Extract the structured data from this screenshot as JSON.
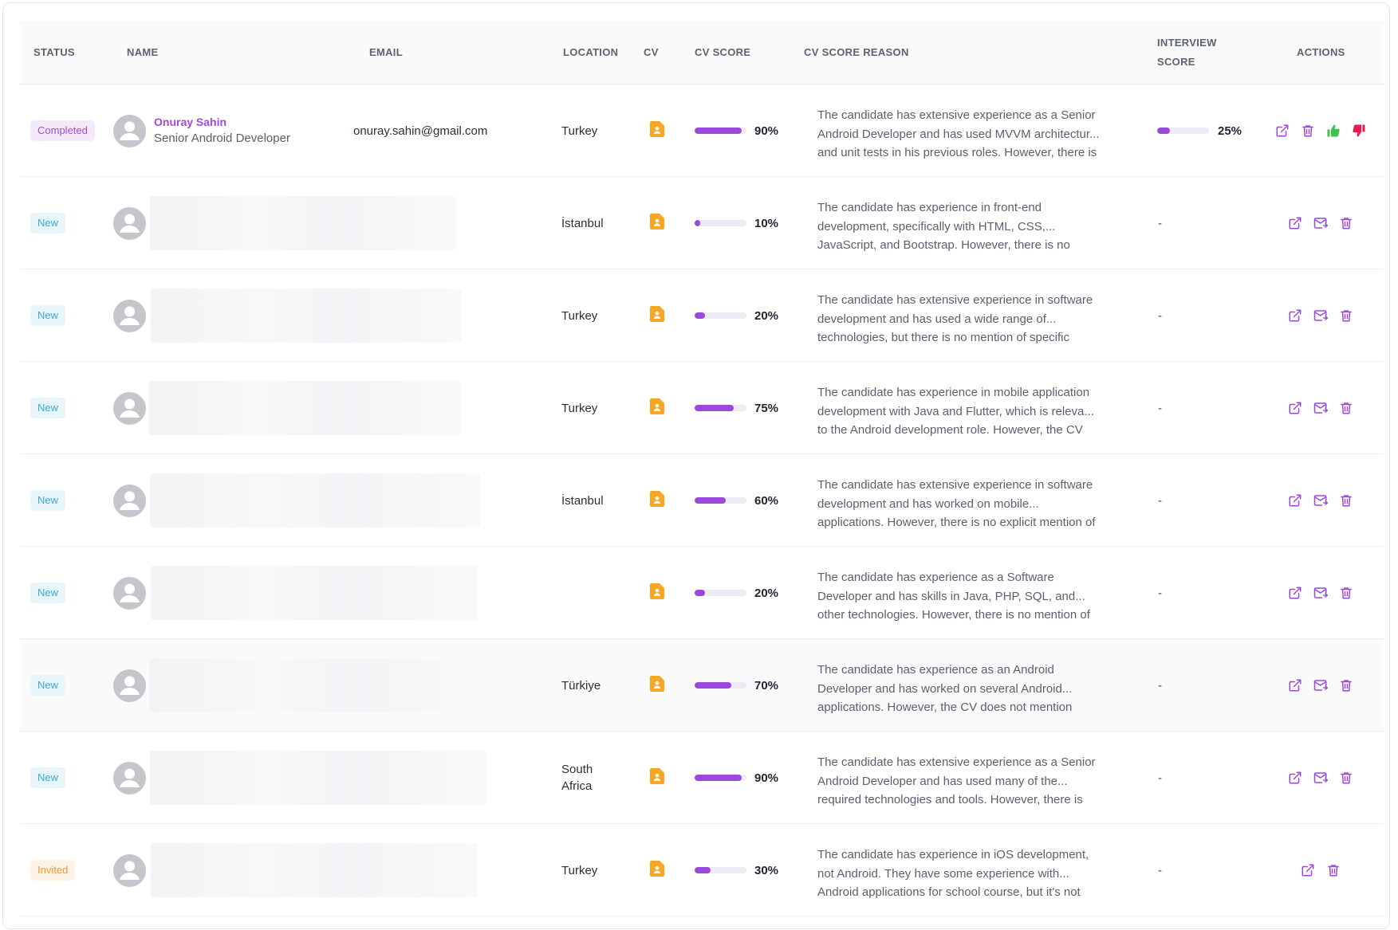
{
  "colors": {
    "accent": "#9a48dd",
    "cv_icon": "#f5a623",
    "thumb_up": "#3cc24a",
    "thumb_down": "#e8194f",
    "badge_completed": "#a649d7",
    "badge_new": "#3ba7d6",
    "badge_invited": "#f29a3a"
  },
  "headers": {
    "status": "STATUS",
    "name": "NAME",
    "email": "EMAIL",
    "location": "LOCATION",
    "cv": "CV",
    "cv_score": "CV SCORE",
    "cv_score_reason": "CV SCORE REASON",
    "interview_line1": "INTERVIEW",
    "interview_line2": "SCORE",
    "actions": "ACTIONS"
  },
  "rows": [
    {
      "status": "Completed",
      "status_type": "completed",
      "name": "Onuray Sahin",
      "role": "Senior Android Developer",
      "email": "onuray.sahin@gmail.com",
      "redacted": false,
      "location_line1": "Turkey",
      "location_line2": "",
      "cv_score": 90,
      "cv_score_label": "90%",
      "reason_lines": [
        "The candidate has extensive experience as a Senior",
        "Android Developer and has used MVVM architectur...",
        "and unit tests in his previous roles. However, there is"
      ],
      "interview_score": 25,
      "interview_label": "25%",
      "actions": [
        "open-external-icon",
        "trash-icon",
        "thumbs-up-icon",
        "thumbs-down-icon"
      ]
    },
    {
      "status": "New",
      "status_type": "new",
      "name": "",
      "role": "",
      "email": "",
      "redacted": true,
      "location_line1": "İstanbul",
      "location_line2": "",
      "cv_score": 10,
      "cv_score_label": "10%",
      "reason_lines": [
        "The candidate has experience in front-end",
        "development, specifically with HTML, CSS,...",
        "JavaScript, and Bootstrap. However, there is no"
      ],
      "interview_label": "-",
      "actions": [
        "open-external-icon",
        "send-mail-icon",
        "trash-icon"
      ]
    },
    {
      "status": "New",
      "status_type": "new",
      "name": "",
      "role": "",
      "email": "",
      "redacted": true,
      "location_line1": "Turkey",
      "location_line2": "",
      "cv_score": 20,
      "cv_score_label": "20%",
      "reason_lines": [
        "The candidate has extensive experience in software",
        "development and has used a wide range of...",
        "technologies, but there is no mention of specific"
      ],
      "interview_label": "-",
      "actions": [
        "open-external-icon",
        "send-mail-icon",
        "trash-icon"
      ]
    },
    {
      "status": "New",
      "status_type": "new",
      "name": "",
      "role": "",
      "email": "",
      "redacted": true,
      "location_line1": "Turkey",
      "location_line2": "",
      "cv_score": 75,
      "cv_score_label": "75%",
      "reason_lines": [
        "The candidate has experience in mobile application",
        "development with Java and Flutter, which is releva...",
        "to the Android development role. However, the CV"
      ],
      "interview_label": "-",
      "actions": [
        "open-external-icon",
        "send-mail-icon",
        "trash-icon"
      ]
    },
    {
      "status": "New",
      "status_type": "new",
      "name": "",
      "role": "",
      "email": "",
      "redacted": true,
      "location_line1": "İstanbul",
      "location_line2": "",
      "cv_score": 60,
      "cv_score_label": "60%",
      "reason_lines": [
        "The candidate has extensive experience in software",
        "development and has worked on mobile...",
        "applications. However, there is no explicit mention of"
      ],
      "interview_label": "-",
      "actions": [
        "open-external-icon",
        "send-mail-icon",
        "trash-icon"
      ]
    },
    {
      "status": "New",
      "status_type": "new",
      "name": "",
      "role": "",
      "email": "",
      "redacted": true,
      "location_line1": "",
      "location_line2": "",
      "cv_score": 20,
      "cv_score_label": "20%",
      "reason_lines": [
        "The candidate has experience as a Software",
        "Developer and has skills in Java, PHP, SQL, and...",
        "other technologies. However, there is no mention of"
      ],
      "interview_label": "-",
      "actions": [
        "open-external-icon",
        "send-mail-icon",
        "trash-icon"
      ]
    },
    {
      "status": "New",
      "status_type": "new",
      "name": "",
      "role": "",
      "email": "",
      "redacted": true,
      "location_line1": "Türkiye",
      "location_line2": "",
      "cv_score": 70,
      "cv_score_label": "70%",
      "reason_lines": [
        "The candidate has experience as an Android",
        "Developer and has worked on several Android...",
        "applications. However, the CV does not mention"
      ],
      "interview_label": "-",
      "actions": [
        "open-external-icon",
        "send-mail-icon",
        "trash-icon"
      ]
    },
    {
      "status": "New",
      "status_type": "new",
      "name": "",
      "role": "",
      "email": "",
      "redacted": true,
      "location_line1": "South",
      "location_line2": "Africa",
      "cv_score": 90,
      "cv_score_label": "90%",
      "reason_lines": [
        "The candidate has extensive experience as a Senior",
        "Android Developer and has used many of the...",
        "required technologies and tools. However, there is"
      ],
      "interview_label": "-",
      "actions": [
        "open-external-icon",
        "send-mail-icon",
        "trash-icon"
      ]
    },
    {
      "status": "Invited",
      "status_type": "invited",
      "name": "",
      "role": "",
      "email": "",
      "redacted": true,
      "location_line1": "Turkey",
      "location_line2": "",
      "cv_score": 30,
      "cv_score_label": "30%",
      "reason_lines": [
        "The candidate has experience in iOS development,",
        "not Android. They have some experience with...",
        "Android applications for school course, but it's not"
      ],
      "interview_label": "-",
      "actions": [
        "open-external-icon",
        "trash-icon"
      ]
    }
  ]
}
